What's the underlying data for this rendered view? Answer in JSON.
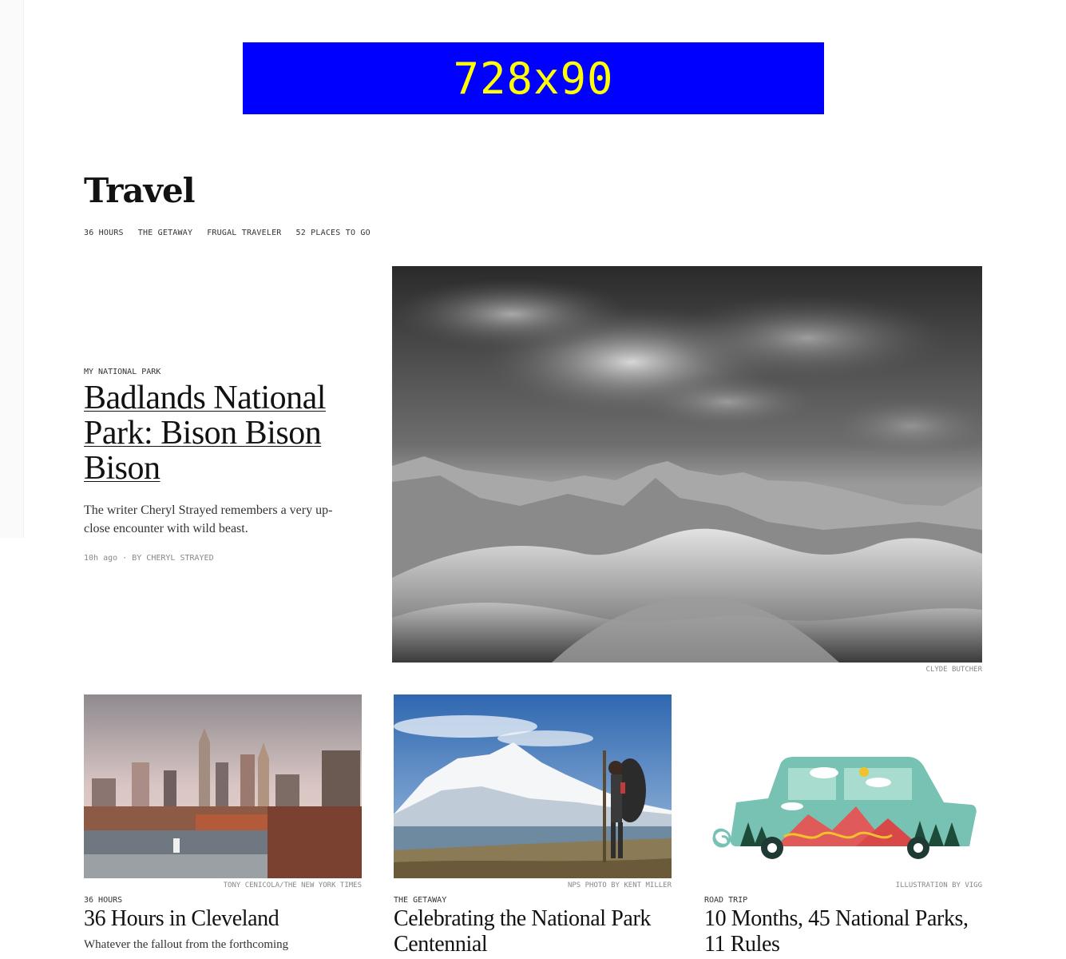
{
  "ad": {
    "label": "728x90",
    "background": "#0000ff",
    "text_color": "#ffff00"
  },
  "section": {
    "title": "Travel",
    "subnav": [
      "36 Hours",
      "The Getaway",
      "Frugal Traveler",
      "52 Places to Go"
    ]
  },
  "lead": {
    "kicker": "My National Park",
    "headline": "Badlands National Park: Bison Bison Bison",
    "summary": "The writer Cheryl Strayed remembers a very up-close encounter with wild beast.",
    "time": "10h ago",
    "byline": "By Cheryl Strayed",
    "image_credit": "Clyde Butcher"
  },
  "cards": [
    {
      "image_credit": "Tony Cenicola/The New York Times",
      "kicker": "36 Hours",
      "headline": "36 Hours in Cleveland",
      "summary": "Whatever the fallout from the forthcoming"
    },
    {
      "image_credit": "NPS Photo by Kent Miller",
      "kicker": "The Getaway",
      "headline": "Celebrating the National Park Centennial",
      "summary": ""
    },
    {
      "image_credit": "Illustration by Vigg",
      "kicker": "Road Trip",
      "headline": "10 Months, 45 National Parks, 11 Rules",
      "summary": ""
    }
  ]
}
